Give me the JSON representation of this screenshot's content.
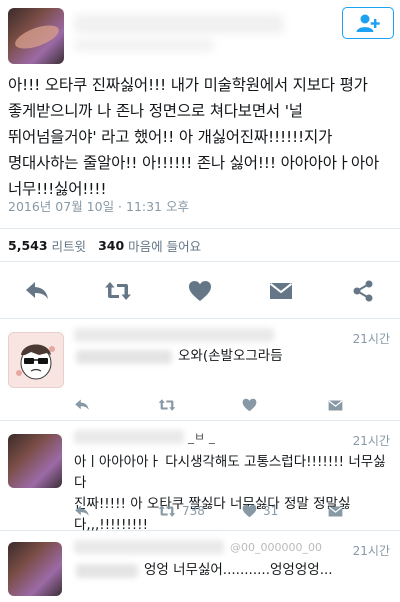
{
  "tweet": {
    "text": "아!!! 오타쿠 진짜싫어!!! 내가 미술학원에서 지보다 평가\n좋게받으니까 나 존나 정면으로 쳐다보면서 '널\n뛰어넘을거야' 라고 했어!! 아 개싫어진짜!!!!!!지가\n명대사하는 줄알아!! 아!!!!!! 존나 싫어!!! 아아아아ㅏ아아\n너무!!!싫어!!!!",
    "timestamp": "2016년 07월 10일 · 11:31 오후",
    "retweets_count": "5,543",
    "retweets_label": "리트윗",
    "likes_count": "340",
    "likes_label": "마음에 들어요"
  },
  "replies": [
    {
      "time": "21시간",
      "text": "오와(손발오그라듬"
    },
    {
      "time": "21시간",
      "header_fragment": "_ㅂ _",
      "text": "아ㅣ아아아아ㅏ 다시생각해도 고통스럽다!!!!!!! 너무싫다\n진짜!!!!! 아 오타쿠 짤싫다 너무싫다 정말 정말싫다,,,!!!!!!!!!",
      "retweets": "738",
      "likes": "31"
    },
    {
      "time": "21시간",
      "handle_fragment": "@00_000000_00",
      "text": "엉엉 너무싫어...........엉엉엉엉..."
    }
  ],
  "colors": {
    "accent": "#1da1f2",
    "icon": "#657786",
    "muted": "#8899a6"
  }
}
